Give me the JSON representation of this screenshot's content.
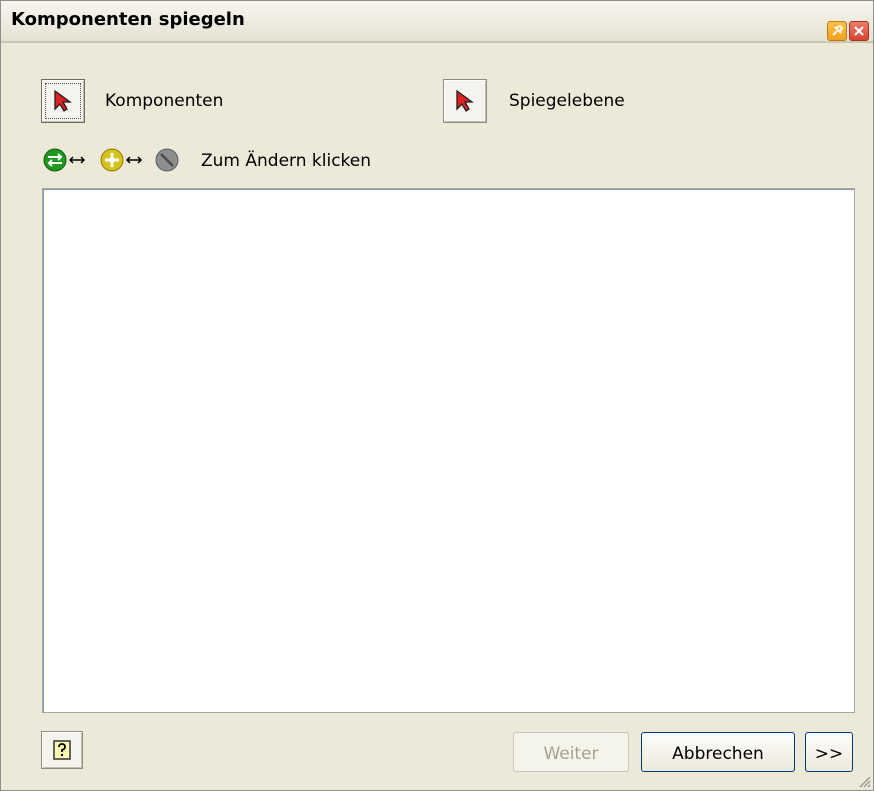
{
  "window": {
    "title": "Komponenten spiegeln"
  },
  "selectors": {
    "components_label": "Komponenten",
    "mirror_plane_label": "Spiegelebene"
  },
  "status": {
    "hint": "Zum Ändern klicken",
    "icons": [
      "mirror-status-icon",
      "swap-arrow-icon",
      "reuse-status-icon",
      "swap-arrow-icon",
      "exclude-status-icon"
    ]
  },
  "components_list": {
    "items": []
  },
  "buttons": {
    "next_label": "Weiter",
    "cancel_label": "Abbrechen",
    "more_label": ">>"
  },
  "colors": {
    "mirror_green": "#1f9a1f",
    "reuse_yellow": "#d8c21a",
    "exclude_gray": "#8e8e8e",
    "pointer_red": "#e02020"
  }
}
